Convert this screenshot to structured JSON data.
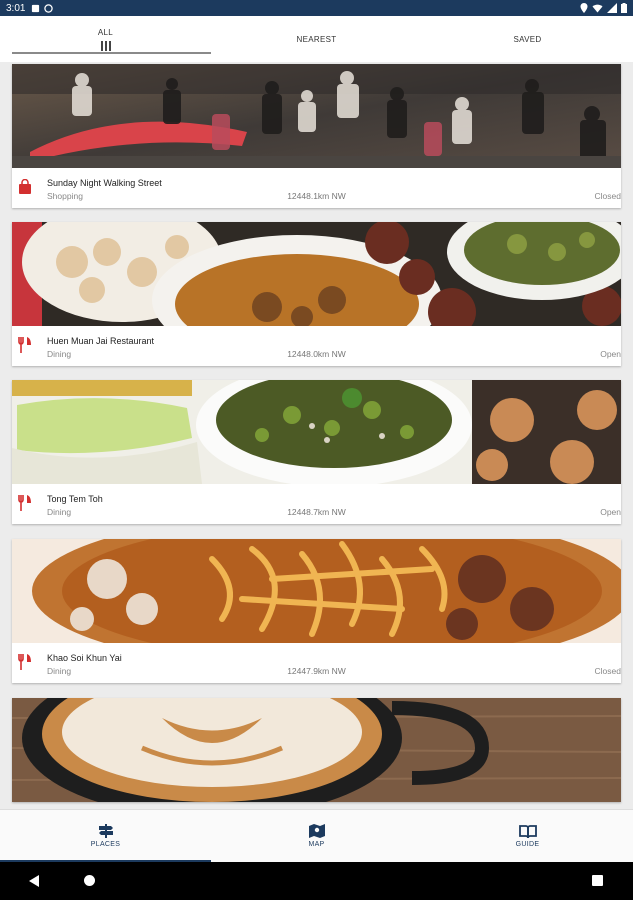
{
  "status_bar": {
    "time": "3:01"
  },
  "tabs": [
    {
      "label": "ALL",
      "active": true
    },
    {
      "label": "NEAREST",
      "active": false
    },
    {
      "label": "SAVED",
      "active": false
    }
  ],
  "places": [
    {
      "name": "Sunday Night Walking Street",
      "category": "Shopping",
      "distance": "12448.1km NW",
      "status": "Closed",
      "icon": "shopping-bag-icon"
    },
    {
      "name": "Huen Muan Jai Restaurant",
      "category": "Dining",
      "distance": "12448.0km NW",
      "status": "Open",
      "icon": "fork-knife-icon"
    },
    {
      "name": "Tong Tem Toh",
      "category": "Dining",
      "distance": "12448.7km NW",
      "status": "Open",
      "icon": "fork-knife-icon"
    },
    {
      "name": "Khao Soi Khun Yai",
      "category": "Dining",
      "distance": "12447.9km NW",
      "status": "Closed",
      "icon": "fork-knife-icon"
    }
  ],
  "bottom_nav": [
    {
      "label": "PLACES",
      "icon": "signpost-icon",
      "active": true
    },
    {
      "label": "MAP",
      "icon": "map-icon",
      "active": false
    },
    {
      "label": "GUIDE",
      "icon": "book-icon",
      "active": false
    }
  ],
  "colors": {
    "primary": "#1c3a5e",
    "accent_red": "#d32f2f"
  }
}
